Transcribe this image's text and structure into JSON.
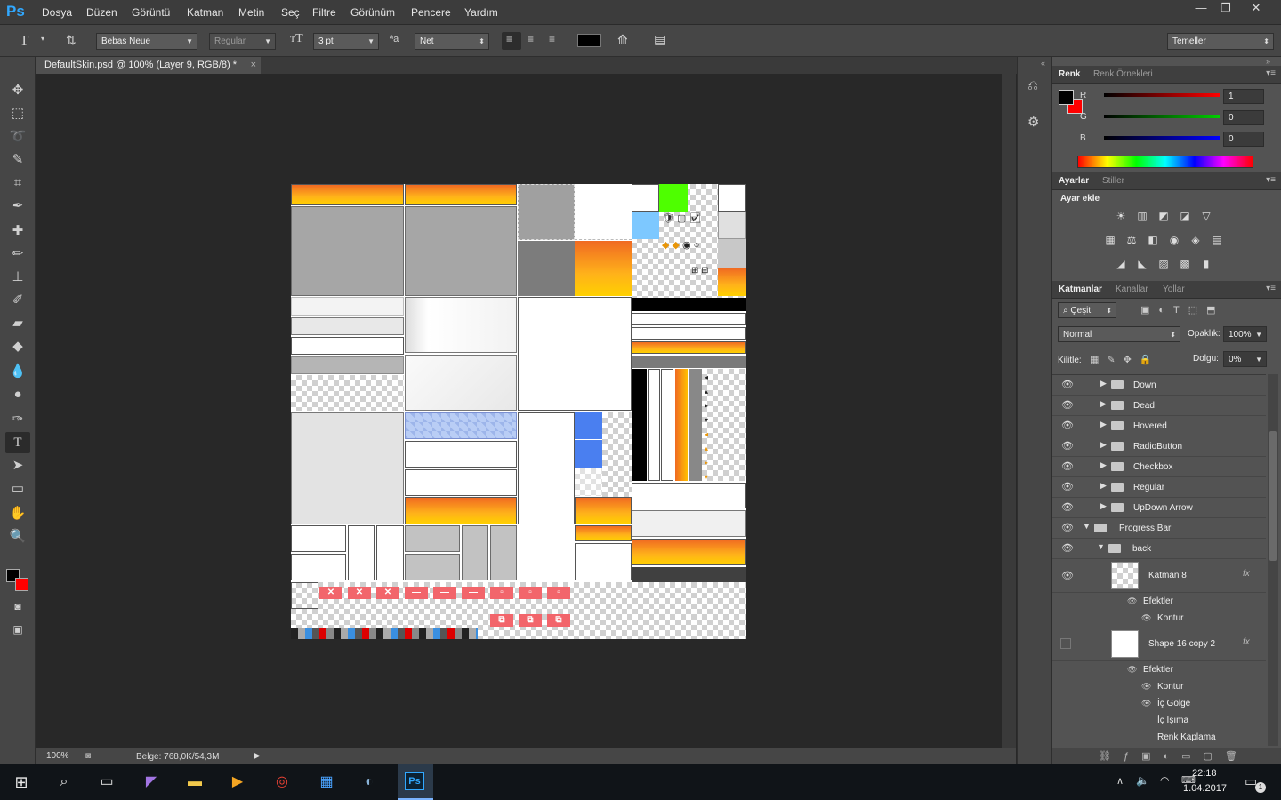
{
  "app": {
    "logo": "Ps"
  },
  "menu": [
    "Dosya",
    "Düzen",
    "Görüntü",
    "Katman",
    "Metin",
    "Seç",
    "Filtre",
    "Görünüm",
    "Pencere",
    "Yardım"
  ],
  "window_controls": {
    "minimize": "—",
    "restore": "❐",
    "close": "✕"
  },
  "options": {
    "font_family": "Bebas Neue",
    "font_style": "Regular",
    "font_size": "3 pt",
    "aa_label": "ªa",
    "antialias": "Net",
    "workspace": "Temeller",
    "text_color": "#000000"
  },
  "document": {
    "tab_title": "DefaultSkin.psd @ 100% (Layer 9, RGB/8) *",
    "tab_close": "×",
    "zoom": "100%",
    "doc_info": "Belge: 768,0K/54,3M"
  },
  "color_panel": {
    "tabs": [
      "Renk",
      "Renk Örnekleri"
    ],
    "channels": [
      {
        "label": "R",
        "value": "1",
        "color": "#ff0000"
      },
      {
        "label": "G",
        "value": "0",
        "color": "#00b400"
      },
      {
        "label": "B",
        "value": "0",
        "color": "#0000ff"
      }
    ],
    "foreground": "#000000",
    "background": "#ff0000"
  },
  "adjustments_panel": {
    "tabs": [
      "Ayarlar",
      "Stiller"
    ],
    "heading": "Ayar ekle",
    "icons": [
      "brightness-icon",
      "levels-icon",
      "curves-icon",
      "exposure-icon",
      "vibrance-icon",
      "hue-saturation-icon",
      "color-balance-icon",
      "black-white-icon",
      "photo-filter-icon",
      "channel-mixer-icon",
      "color-lookup-icon",
      "invert-icon",
      "posterize-icon",
      "threshold-icon",
      "gradient-map-icon",
      "selective-color-icon"
    ]
  },
  "layers_panel": {
    "tabs": [
      "Katmanlar",
      "Kanallar",
      "Yollar"
    ],
    "filter": "Çeşit",
    "blend_mode": "Normal",
    "opacity_label": "Opaklık:",
    "opacity": "100%",
    "lock_label": "Kilitle:",
    "fill_label": "Dolgu:",
    "fill": "0%",
    "groups": [
      "Down",
      "Dead",
      "Hovered",
      "RadioButton",
      "Checkbox",
      "Regular",
      "UpDown Arrow"
    ],
    "open_group": "Progress Bar",
    "sub_group": "back",
    "layer1": {
      "name": "Katman 8",
      "effects": "Efektler",
      "stroke": "Kontur"
    },
    "layer2": {
      "name": "Shape 16 copy 2",
      "effects": "Efektler",
      "stroke": "Kontur",
      "inner_shadow": "İç Gölge",
      "inner_glow": "İç Işıma",
      "color_overlay": "Renk Kaplama"
    },
    "fx": "fx"
  },
  "taskbar": {
    "time": "22:18",
    "date": "1.04.2017",
    "notif_count": "1"
  }
}
